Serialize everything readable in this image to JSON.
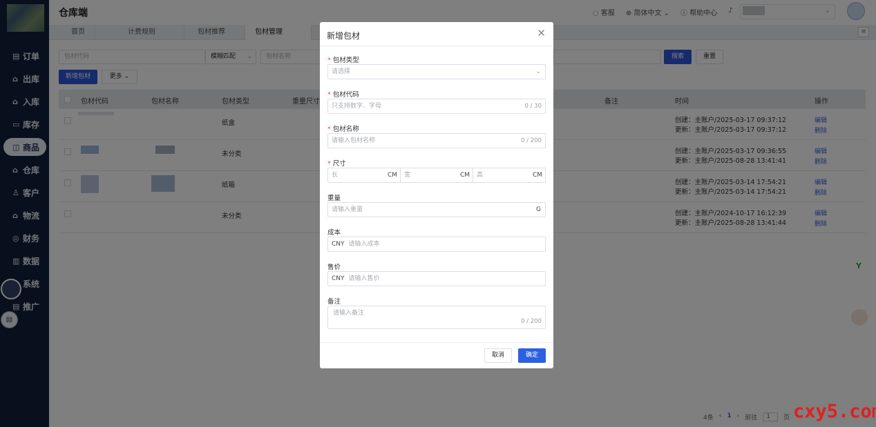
{
  "app": {
    "title": "仓库端"
  },
  "topbar": {
    "service": "客服",
    "language": "简体中文",
    "help": "帮助中心"
  },
  "sidebar": {
    "items": [
      {
        "label": "订单",
        "icon": "clipboard-icon"
      },
      {
        "label": "出库",
        "icon": "outbound-icon"
      },
      {
        "label": "入库",
        "icon": "inbound-icon"
      },
      {
        "label": "库存",
        "icon": "stock-icon"
      },
      {
        "label": "商品",
        "icon": "goods-icon"
      },
      {
        "label": "仓库",
        "icon": "warehouse-icon"
      },
      {
        "label": "客户",
        "icon": "customer-icon"
      },
      {
        "label": "物流",
        "icon": "logistics-icon"
      },
      {
        "label": "财务",
        "icon": "finance-icon"
      },
      {
        "label": "数据",
        "icon": "chart-icon"
      },
      {
        "label": "系统",
        "icon": "system-icon"
      },
      {
        "label": "推广",
        "icon": "promote-icon"
      }
    ]
  },
  "tabs": [
    {
      "label": "首页"
    },
    {
      "label": "计费规则"
    },
    {
      "label": "包材推荐"
    },
    {
      "label": "包材管理",
      "close": "×"
    }
  ],
  "search": {
    "code_placeholder": "包材代码",
    "match_mode": "模糊匹配",
    "name_placeholder": "包材名称",
    "search_btn": "搜索",
    "reset_btn": "重置"
  },
  "toolbar": {
    "add_btn": "新增包材",
    "more_btn": "更多"
  },
  "table": {
    "columns": [
      "包材代码",
      "包材名称",
      "包材类型",
      "重量尺寸",
      "备注",
      "时间",
      "操作"
    ],
    "rows": [
      {
        "type": "纸盒",
        "created": "创建：主账户/2025-03-17 09:37:12",
        "updated": "更新：主账户/2025-03-17 09:37:12"
      },
      {
        "type": "未分类",
        "created": "创建：主账户/2025-03-17 09:36:55",
        "updated": "更新：主账户/2025-08-28 13:41:41"
      },
      {
        "type": "纸箱",
        "created": "创建：主账户/2025-03-14 17:54:21",
        "updated": "更新：主账户/2025-03-14 17:54:21"
      },
      {
        "type": "未分类",
        "created": "创建：主账户/2024-10-17 16:12:39",
        "updated": "更新：主账户/2025-08-28 13:41:44"
      }
    ],
    "edit": "编辑",
    "delete": "删除"
  },
  "pager": {
    "total": "4条",
    "current": "1",
    "goto": "前往",
    "page_input": "1",
    "page_unit": "页"
  },
  "modal": {
    "title": "新增包材",
    "type_label": "包材类型",
    "type_placeholder": "请选择",
    "code_label": "包材代码",
    "code_placeholder": "只支持数字、字母",
    "code_count": "0 / 30",
    "name_label": "包材名称",
    "name_placeholder": "请输入包材名称",
    "name_count": "0 / 200",
    "size_label": "尺寸",
    "length": "长",
    "width": "宽",
    "height": "高",
    "unit_cm": "CM",
    "weight_label": "重量",
    "weight_placeholder": "请输入重量",
    "unit_g": "G",
    "cost_label": "成本",
    "cost_prefix": "CNY",
    "cost_placeholder": "请输入成本",
    "price_label": "售价",
    "price_prefix": "CNY",
    "price_placeholder": "请输入售价",
    "remark_label": "备注",
    "remark_placeholder": "请输入备注",
    "remark_count": "0 / 200",
    "cancel": "取消",
    "confirm": "确定"
  },
  "watermark": "cxy5.com"
}
